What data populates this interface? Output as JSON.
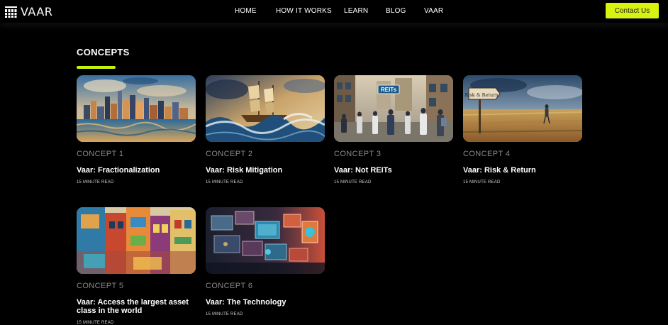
{
  "header": {
    "logo_text": "VAAR",
    "nav": [
      "HOME",
      "HOW IT WORKS",
      "LEARN",
      "BLOG",
      "VAAR"
    ],
    "contact_label": "Contact Us"
  },
  "colors": {
    "accent": "#d7f20f",
    "background": "#000000",
    "muted": "#8a8a8a"
  },
  "section": {
    "title": "CONCEPTS"
  },
  "cards": [
    {
      "number": "CONCEPT 1",
      "title": "Vaar: Fractionalization",
      "read_time": "15 MINUTE READ",
      "image": "city-skyline-painting",
      "sign": ""
    },
    {
      "number": "CONCEPT 2",
      "title": "Vaar: Risk Mitigation",
      "read_time": "15 MINUTE READ",
      "image": "ship-storm-painting",
      "sign": ""
    },
    {
      "number": "CONCEPT 3",
      "title": "Vaar: Not REITs",
      "read_time": "15 MINUTE READ",
      "image": "street-crowd-painting",
      "sign": "REITs"
    },
    {
      "number": "CONCEPT 4",
      "title": "Vaar: Risk & Return",
      "read_time": "15 MINUTE READ",
      "image": "field-signpost-painting",
      "sign": "Risk & Return"
    },
    {
      "number": "CONCEPT 5",
      "title": "Vaar: Access the largest asset class in the world",
      "read_time": "15 MINUTE READ",
      "image": "colorful-buildings-painting",
      "sign": ""
    },
    {
      "number": "CONCEPT 6",
      "title": "Vaar: The Technology",
      "read_time": "15 MINUTE READ",
      "image": "tech-screens-painting",
      "sign": ""
    }
  ]
}
